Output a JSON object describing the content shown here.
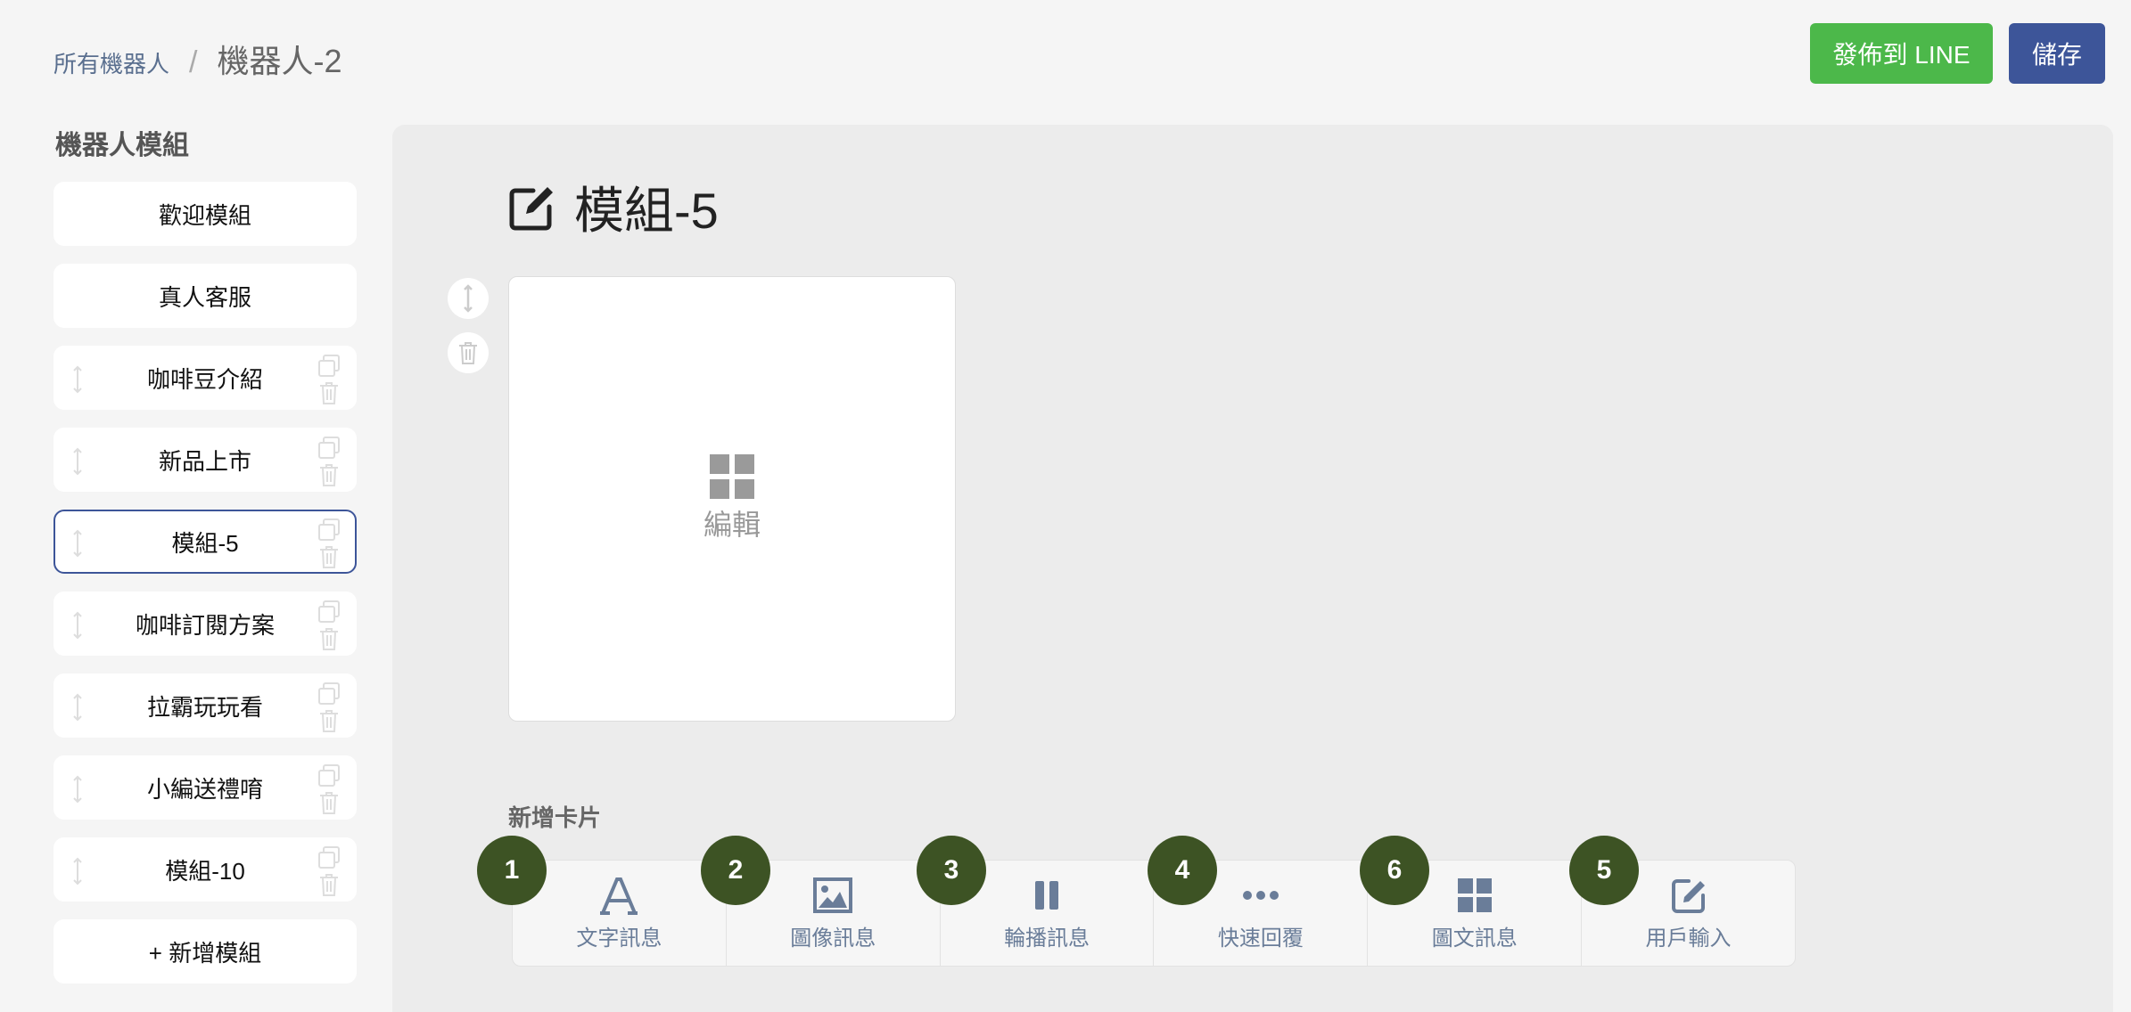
{
  "header": {
    "breadcrumb_link": "所有機器人",
    "breadcrumb_sep": "/",
    "breadcrumb_current": "機器人-2",
    "publish_label": "發佈到 LINE",
    "save_label": "儲存"
  },
  "sidebar": {
    "title": "機器人模組",
    "items": [
      {
        "label": "歡迎模組"
      },
      {
        "label": "真人客服"
      },
      {
        "label": "咖啡豆介紹"
      },
      {
        "label": "新品上市"
      },
      {
        "label": "模組-5"
      },
      {
        "label": "咖啡訂閱方案"
      },
      {
        "label": "拉霸玩玩看"
      },
      {
        "label": "小編送禮唷"
      },
      {
        "label": "模組-10"
      }
    ],
    "add_label": "+ 新增模組"
  },
  "main": {
    "module_title": "模組-5",
    "card_edit_label": "編輯",
    "add_card_label": "新增卡片",
    "card_types": [
      {
        "label": "文字訊息",
        "icon": "text-icon"
      },
      {
        "label": "圖像訊息",
        "icon": "image-icon"
      },
      {
        "label": "輪播訊息",
        "icon": "carousel-icon"
      },
      {
        "label": "快速回覆",
        "icon": "quick-reply-icon"
      },
      {
        "label": "圖文訊息",
        "icon": "imagemap-icon"
      },
      {
        "label": "用戶輸入",
        "icon": "user-input-icon"
      }
    ],
    "step_badges": [
      "1",
      "2",
      "3",
      "4",
      "6",
      "5"
    ]
  },
  "colors": {
    "publish": "#4cb84a",
    "save": "#3d5599",
    "badge": "#3d5324",
    "active_border": "#3d5599"
  }
}
